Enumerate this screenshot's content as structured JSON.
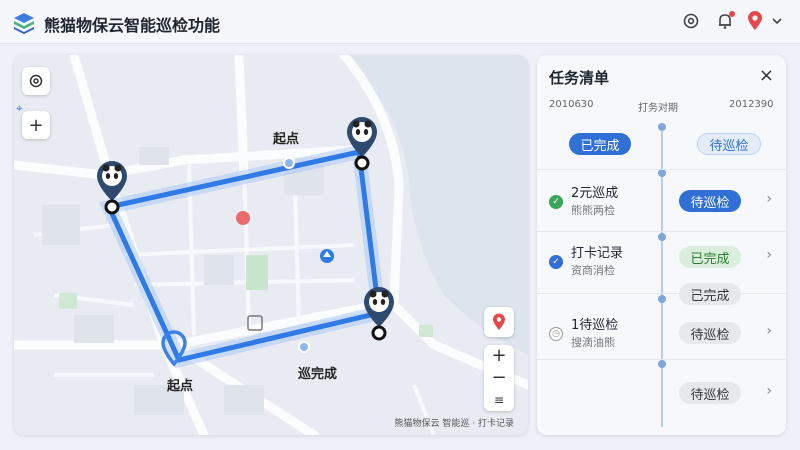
{
  "app": {
    "title": "熊猫物保云智能巡检功能",
    "accent": "#2f6fd6"
  },
  "header": {
    "icons": [
      "settings-gear-icon",
      "bell-icon",
      "location-pin-icon",
      "chevron-down-icon"
    ]
  },
  "map": {
    "labels": {
      "start_top": "起点",
      "start_bottom": "起点",
      "route_done": "巡完成"
    },
    "attribution": "熊猫物保云 智能巡 · 打卡记录",
    "controls": {
      "zoom_in": "+",
      "zoom_out": "−"
    }
  },
  "task_panel": {
    "title": "任务清单",
    "close": "×",
    "date_left": "2010630",
    "date_mid": "打务对期",
    "date_right": "2012390",
    "status_done_header": "已完成",
    "status_pending_header": "待巡检",
    "rows": [
      {
        "title": "2元巡成",
        "subtitle": "熊熊两检",
        "status": "待巡检",
        "icon": "check-circle-green-icon"
      },
      {
        "title": "打卡记录",
        "subtitle": "资商消检",
        "status": "已完成",
        "status2": "已完成",
        "icon": "check-circle-blue-icon"
      },
      {
        "title": "1待巡检",
        "subtitle": "搜滴油熊",
        "status": "待巡检",
        "icon": "clock-icon"
      },
      {
        "title": "",
        "subtitle": "",
        "status": "待巡检",
        "icon": ""
      }
    ]
  }
}
